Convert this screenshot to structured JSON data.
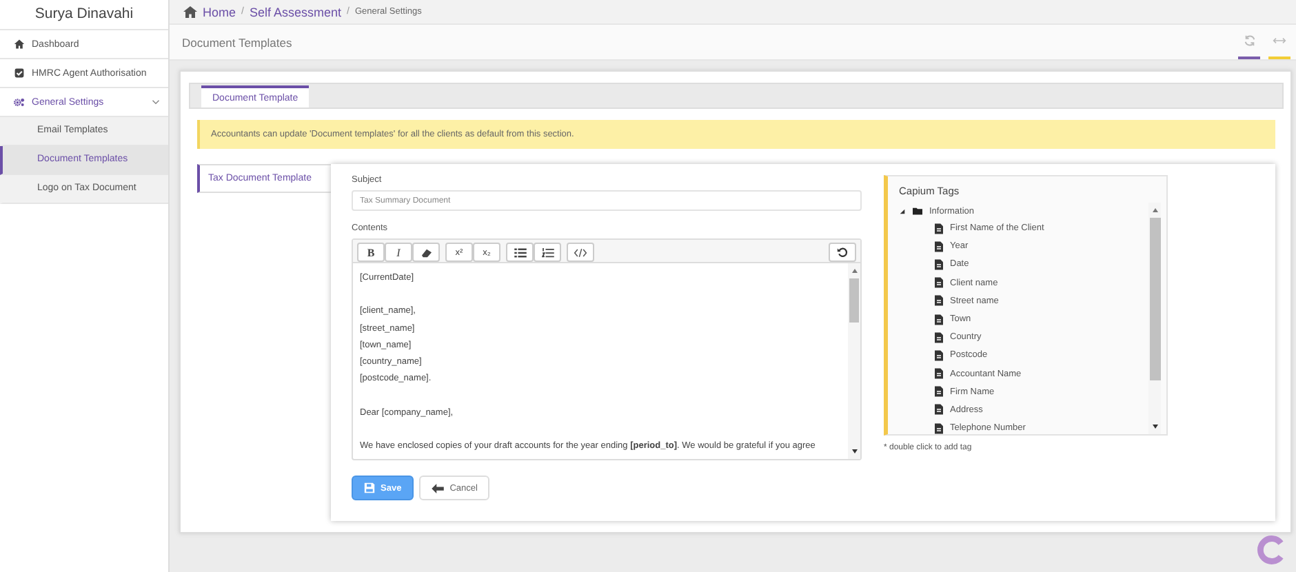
{
  "sidebar": {
    "user_name": "Surya Dinavahi",
    "items": [
      {
        "label": "Dashboard",
        "kind": "home",
        "selected": false
      },
      {
        "label": "HMRC Agent Authorisation",
        "kind": "check",
        "selected": false
      },
      {
        "label": "General Settings",
        "kind": "gears",
        "selected": true,
        "expanded": true,
        "children": [
          {
            "label": "Email Templates",
            "selected": false
          },
          {
            "label": "Document Templates",
            "selected": true
          },
          {
            "label": "Logo on Tax Document",
            "selected": false
          }
        ]
      }
    ]
  },
  "breadcrumb": [
    {
      "label": "Home",
      "kind": "link"
    },
    {
      "label": "/",
      "kind": "separator"
    },
    {
      "label": "Self Assessment",
      "kind": "link"
    },
    {
      "label": "/",
      "kind": "separator"
    },
    {
      "label": "General Settings",
      "kind": "current"
    }
  ],
  "page_title": "Document Templates",
  "tabs": [
    {
      "label": "Document Template",
      "selected": true
    }
  ],
  "alert": "Accountants can update 'Document templates' for all the clients as default from this section.",
  "side_tabs": [
    {
      "label": "Tax Document Template",
      "selected": true
    }
  ],
  "form": {
    "subject_label": "Subject",
    "subject_value": "Tax Summary Document",
    "contents_label": "Contents",
    "toolbar": [
      {
        "kind": "bold",
        "label": "B"
      },
      {
        "kind": "italic",
        "label": "I"
      },
      {
        "kind": "eraser"
      },
      {
        "kind": "sup",
        "label": "x²"
      },
      {
        "kind": "sub",
        "label": "x₂"
      },
      {
        "kind": "ul"
      },
      {
        "kind": "ol"
      },
      {
        "kind": "code"
      },
      {
        "kind": "undo"
      }
    ],
    "content_blocks": [
      [
        "[CurrentDate]"
      ],
      [
        "[client_name],",
        "[street_name]",
        "[town_name]",
        "[country_name]",
        "[postcode_name]."
      ],
      [
        "Dear [company_name],"
      ],
      [
        "We have enclosed copies of your draft accounts for the year ending **[period_to]**. We would be grateful if you agree"
      ]
    ],
    "save_label": "Save",
    "cancel_label": "Cancel"
  },
  "tags": {
    "title": "Capium Tags",
    "group": {
      "label": "Information",
      "expanded": true,
      "children": [
        "First Name of the Client",
        "Year",
        "Date",
        "Client name",
        "Street name",
        "Town",
        "Country",
        "Postcode",
        "Accountant Name",
        "Firm Name",
        "Address",
        "Telephone Number"
      ]
    },
    "hint": "* double click to add tag"
  }
}
